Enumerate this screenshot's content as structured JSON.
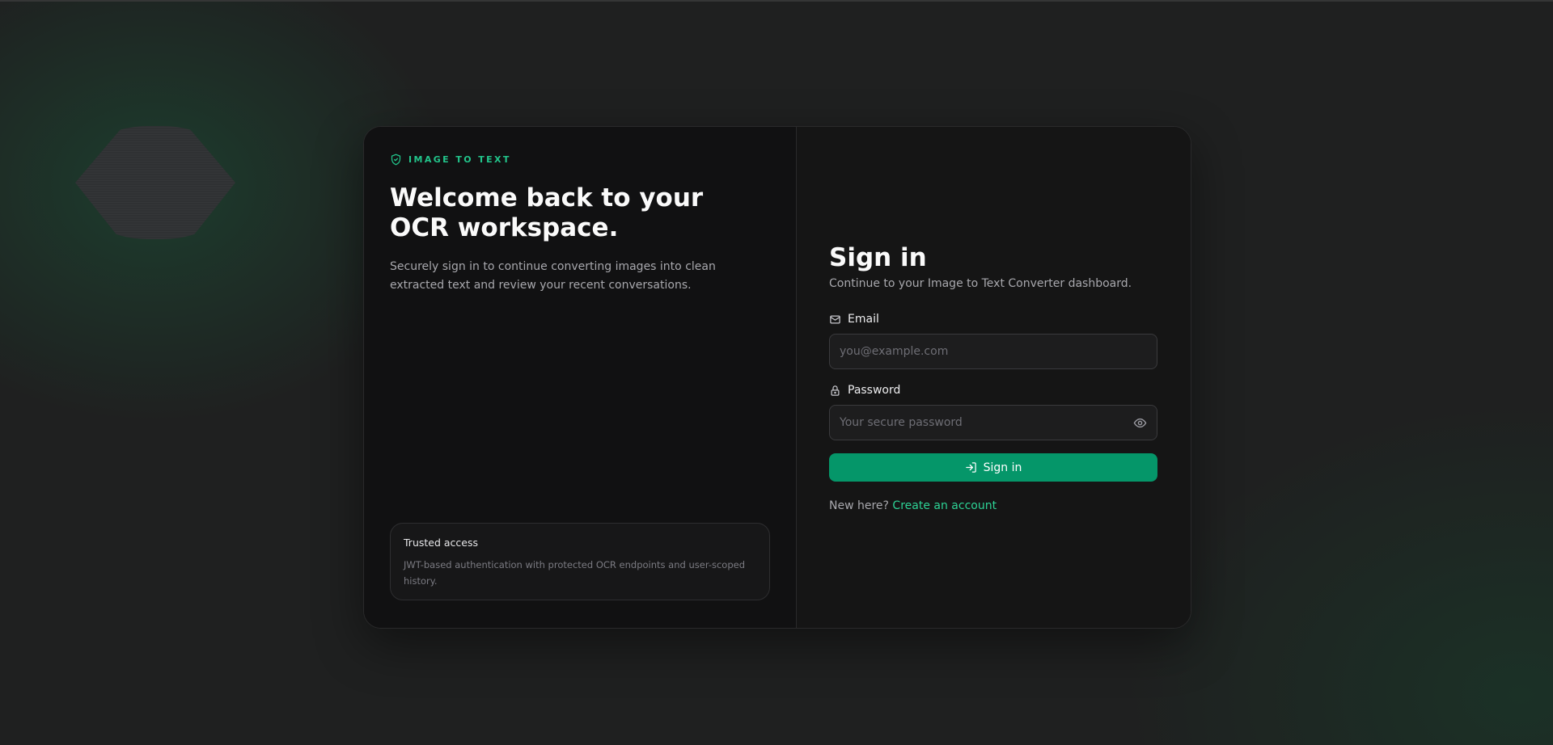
{
  "brand": {
    "label": "IMAGE TO TEXT",
    "icon": "shield-check-icon",
    "accent_color": "#22c58b"
  },
  "hero": {
    "title": "Welcome back to your OCR workspace.",
    "description": "Securely sign in to continue converting images into clean extracted text and review your recent conversations."
  },
  "trust": {
    "title": "Trusted access",
    "description": "JWT-based authentication with protected OCR endpoints and user-scoped history."
  },
  "signin": {
    "title": "Sign in",
    "subtitle": "Continue to your Image to Text Converter dashboard.",
    "email": {
      "label": "Email",
      "icon": "mail-icon",
      "placeholder": "you@example.com",
      "value": ""
    },
    "password": {
      "label": "Password",
      "icon": "lock-icon",
      "placeholder": "Your secure password",
      "value": "",
      "toggle_icon": "eye-icon"
    },
    "button": {
      "label": "Sign in",
      "icon": "log-in-icon",
      "color": "#059669"
    },
    "footer": {
      "prompt": "New here?",
      "link_label": "Create an account"
    }
  }
}
